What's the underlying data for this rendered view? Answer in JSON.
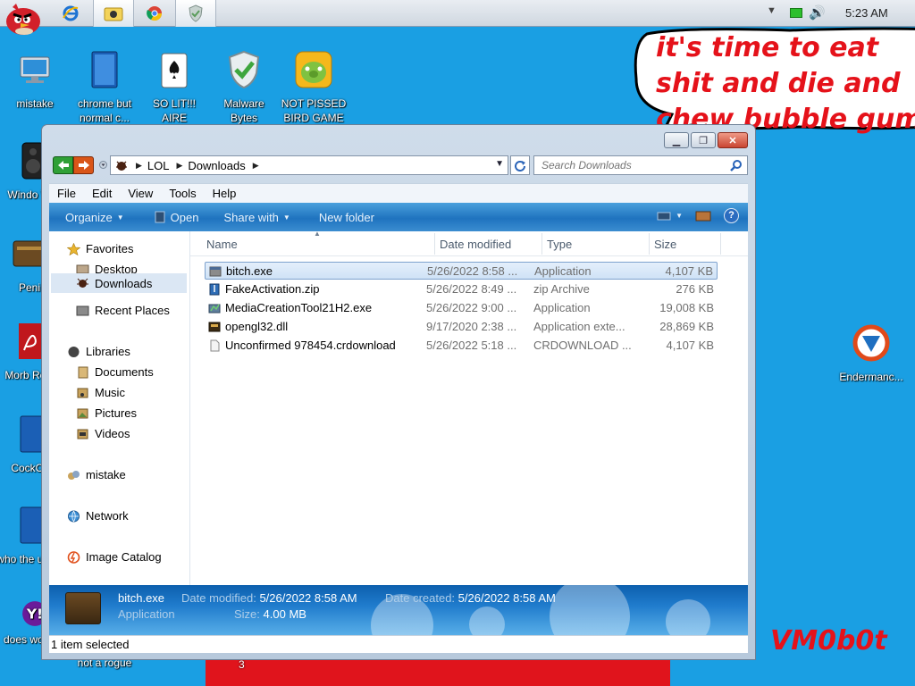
{
  "taskbar": {
    "clock": "5:23 AM",
    "tray_chevron": "▼",
    "volume_glyph": "🔊"
  },
  "desktop": {
    "icons": [
      {
        "label": "mistake",
        "icon": "computer-icon"
      },
      {
        "label": "chrome but normal c...",
        "icon": "chrome-blue-icon"
      },
      {
        "label": "SO LIT!!! AIRE",
        "icon": "solitaire-icon"
      },
      {
        "label": "Malware Bytes",
        "icon": "shield-check-icon"
      },
      {
        "label": "NOT PISSED BIRD GAME",
        "icon": "bad-piggies-icon"
      },
      {
        "label": "Windo Vist",
        "icon": "speaker-icon"
      },
      {
        "label": "Peni",
        "icon": "wallet-icon"
      },
      {
        "label": "Morb Read",
        "icon": "pdf-icon"
      },
      {
        "label": "CockCle",
        "icon": "blue-app-icon"
      },
      {
        "label": "who the uses t",
        "icon": "blue-app-icon"
      },
      {
        "label": "does work lol",
        "icon": "yahoo-icon"
      },
      {
        "label": "not a rogue",
        "icon": "app-icon"
      },
      {
        "label": "Endermanc...",
        "icon": "endermanch-icon"
      }
    ],
    "bubble_text": "it's time to eat shit and die and chew bubble gum",
    "cartoon_number": "3",
    "signature": "VM0b0t"
  },
  "explorer": {
    "address_segments": [
      "LOL",
      "Downloads"
    ],
    "search_placeholder": "Search Downloads",
    "menu": [
      "File",
      "Edit",
      "View",
      "Tools",
      "Help"
    ],
    "commands": [
      {
        "label": "Organize",
        "dropdown": true
      },
      {
        "label": "Open",
        "dropdown": false
      },
      {
        "label": "Share with",
        "dropdown": true
      },
      {
        "label": "New folder",
        "dropdown": false
      }
    ],
    "nav": {
      "favorites": "Favorites",
      "favorites_items": [
        "Desktop",
        "Downloads",
        "Recent Places"
      ],
      "libraries": "Libraries",
      "libraries_items": [
        "Documents",
        "Music",
        "Pictures",
        "Videos"
      ],
      "homegroup": "mistake",
      "network": "Network",
      "image_catalog": "Image Catalog"
    },
    "columns": [
      "Name",
      "Date modified",
      "Type",
      "Size"
    ],
    "files": [
      {
        "name": "bitch.exe",
        "date": "5/26/2022 8:58 ...",
        "type": "Application",
        "size": "4,107 KB",
        "icon": "exe-icon",
        "selected": true
      },
      {
        "name": "FakeActivation.zip",
        "date": "5/26/2022 8:49 ...",
        "type": "zip Archive",
        "size": "276 KB",
        "icon": "zip-icon",
        "selected": false
      },
      {
        "name": "MediaCreationTool21H2.exe",
        "date": "5/26/2022 9:00 ...",
        "type": "Application",
        "size": "19,008 KB",
        "icon": "installer-icon",
        "selected": false
      },
      {
        "name": "opengl32.dll",
        "date": "9/17/2020 2:38 ...",
        "type": "Application exte...",
        "size": "28,869 KB",
        "icon": "dll-icon",
        "selected": false
      },
      {
        "name": "Unconfirmed 978454.crdownload",
        "date": "5/26/2022 5:18 ...",
        "type": "CRDOWNLOAD ...",
        "size": "4,107 KB",
        "icon": "file-icon",
        "selected": false
      }
    ],
    "details": {
      "name": "bitch.exe",
      "type": "Application",
      "date_modified_label": "Date modified:",
      "date_modified": "5/26/2022 8:58 AM",
      "size_label": "Size:",
      "size": "4.00 MB",
      "date_created_label": "Date created:",
      "date_created": "5/26/2022 8:58 AM"
    },
    "status": "1 item selected"
  }
}
